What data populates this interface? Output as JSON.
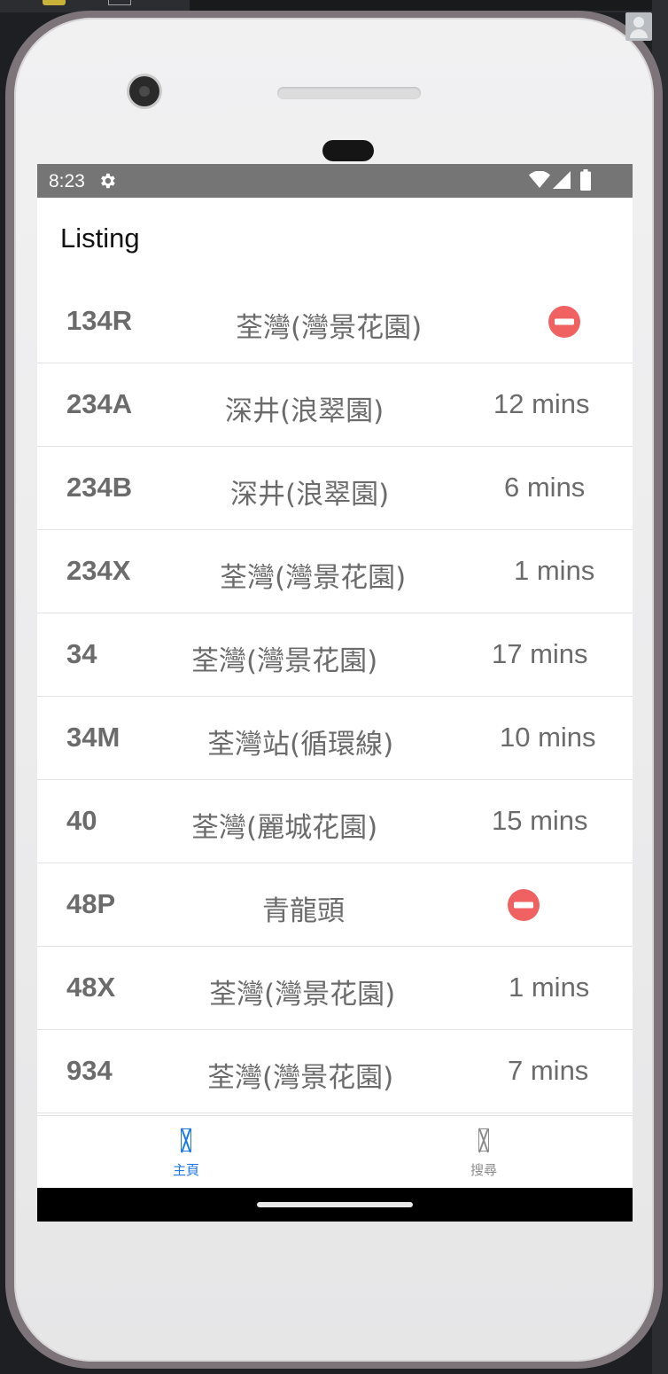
{
  "status_bar": {
    "time": "8:23",
    "icons": [
      "gear-icon",
      "wifi-icon",
      "signal-icon",
      "battery-icon"
    ]
  },
  "header": {
    "title": "Listing"
  },
  "routes": [
    {
      "route": "134R",
      "destination": "荃灣(灣景花園)",
      "eta": "",
      "status_icon": "no-entry-icon"
    },
    {
      "route": "234A",
      "destination": "深井(浪翠園)",
      "eta": "12 mins"
    },
    {
      "route": "234B",
      "destination": "深井(浪翠園)",
      "eta": "6 mins"
    },
    {
      "route": "234X",
      "destination": "荃灣(灣景花園)",
      "eta": "1 mins"
    },
    {
      "route": "34",
      "destination": "荃灣(灣景花園)",
      "eta": "17 mins"
    },
    {
      "route": "34M",
      "destination": "荃灣站(循環線)",
      "eta": "10 mins"
    },
    {
      "route": "40",
      "destination": "荃灣(麗城花園)",
      "eta": "15 mins"
    },
    {
      "route": "48P",
      "destination": "青龍頭",
      "eta": "",
      "status_icon": "no-entry-icon"
    },
    {
      "route": "48X",
      "destination": "荃灣(灣景花園)",
      "eta": "1 mins"
    },
    {
      "route": "934",
      "destination": "荃灣(灣景花園)",
      "eta": "7 mins"
    }
  ],
  "tabs": [
    {
      "label": "主頁",
      "active": true,
      "color": "#1e78e6"
    },
    {
      "label": "搜尋",
      "active": false,
      "color": "#8c8c8c"
    }
  ],
  "colors": {
    "status_bar": "#757575",
    "row_text": "#6b6b6b",
    "no_entry": "#f06262",
    "tab_active": "#1e78e6"
  }
}
